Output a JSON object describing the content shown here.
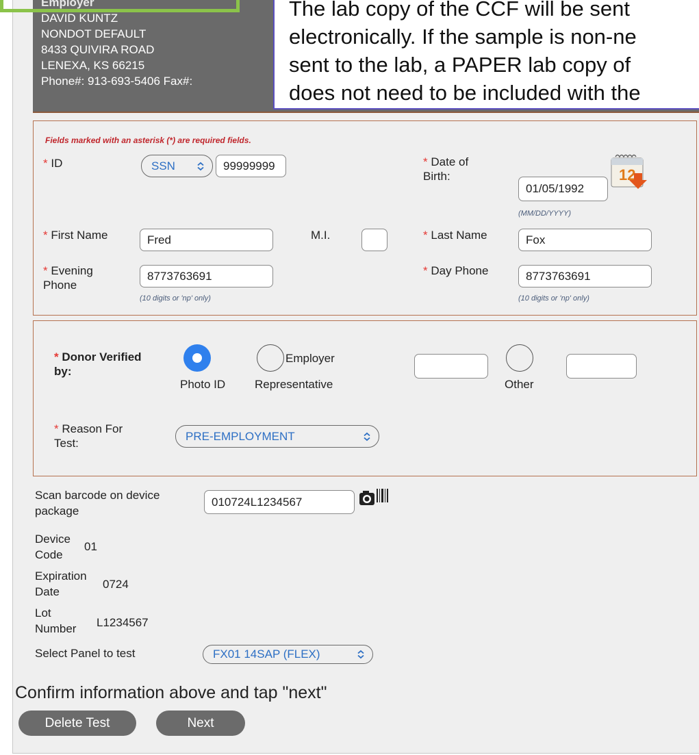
{
  "employer": {
    "title": "Employer",
    "lines": [
      "DAVID KUNTZ",
      "NONDOT DEFAULT",
      "8433 QUIVIRA ROAD",
      "LENEXA, KS 66215",
      "Phone#: 913-693-5406 Fax#:"
    ]
  },
  "overlay": {
    "lines": [
      "The lab copy of the CCF will be sent",
      "electronically. If the sample is non-ne",
      "sent to the lab, a PAPER lab copy of",
      "does not need to be included with the"
    ]
  },
  "donor_form": {
    "required_note": "Fields marked with an asterisk (*) are required fields.",
    "asterisk": "*",
    "id_label": "ID",
    "id_type": "SSN",
    "id_value": "99999999",
    "dob_label_1": "Date of",
    "dob_label_2": "Birth:",
    "dob_value": "01/05/1992",
    "dob_hint": "(MM/DD/YYYY)",
    "first_name_label": "First Name",
    "first_name_value": "Fred",
    "mi_label": "M.I.",
    "mi_value": "",
    "last_name_label": "Last Name",
    "last_name_value": "Fox",
    "evening_phone_label_1": "Evening",
    "evening_phone_label_2": "Phone",
    "evening_phone_value": "8773763691",
    "evening_phone_hint": "(10 digits or 'np' only)",
    "day_phone_label": "Day Phone",
    "day_phone_value": "8773763691",
    "day_phone_hint": "(10 digits or 'np' only)"
  },
  "verification": {
    "label_1": "Donor Verified",
    "label_2": "by:",
    "photo_id": "Photo ID",
    "employer": "Employer",
    "representative": "Representative",
    "other": "Other",
    "selected": "Photo ID",
    "reason_label_1": "Reason For",
    "reason_label_2": "Test:",
    "reason_value": "PRE-EMPLOYMENT"
  },
  "device": {
    "scan_label_1": "Scan barcode on device",
    "scan_label_2": "package",
    "barcode_value": "010724L1234567",
    "device_code_label_1": "Device",
    "device_code_label_2": "Code",
    "device_code_value": "01",
    "expiration_label_1": "Expiration",
    "expiration_label_2": "Date",
    "expiration_value": "0724",
    "lot_label_1": "Lot",
    "lot_label_2": "Number",
    "lot_value": "L1234567",
    "panel_label": "Select Panel to test",
    "panel_value": "FX01 14SAP (FLEX)"
  },
  "footer": {
    "confirm_text": "Confirm information above and tap \"next\"",
    "delete_label": "Delete Test",
    "next_label": "Next"
  },
  "colors": {
    "accent_blue": "#2f80ed",
    "required_red": "#e53935",
    "panel_border": "#b5714f",
    "highlight_green": "#8bc34a"
  }
}
